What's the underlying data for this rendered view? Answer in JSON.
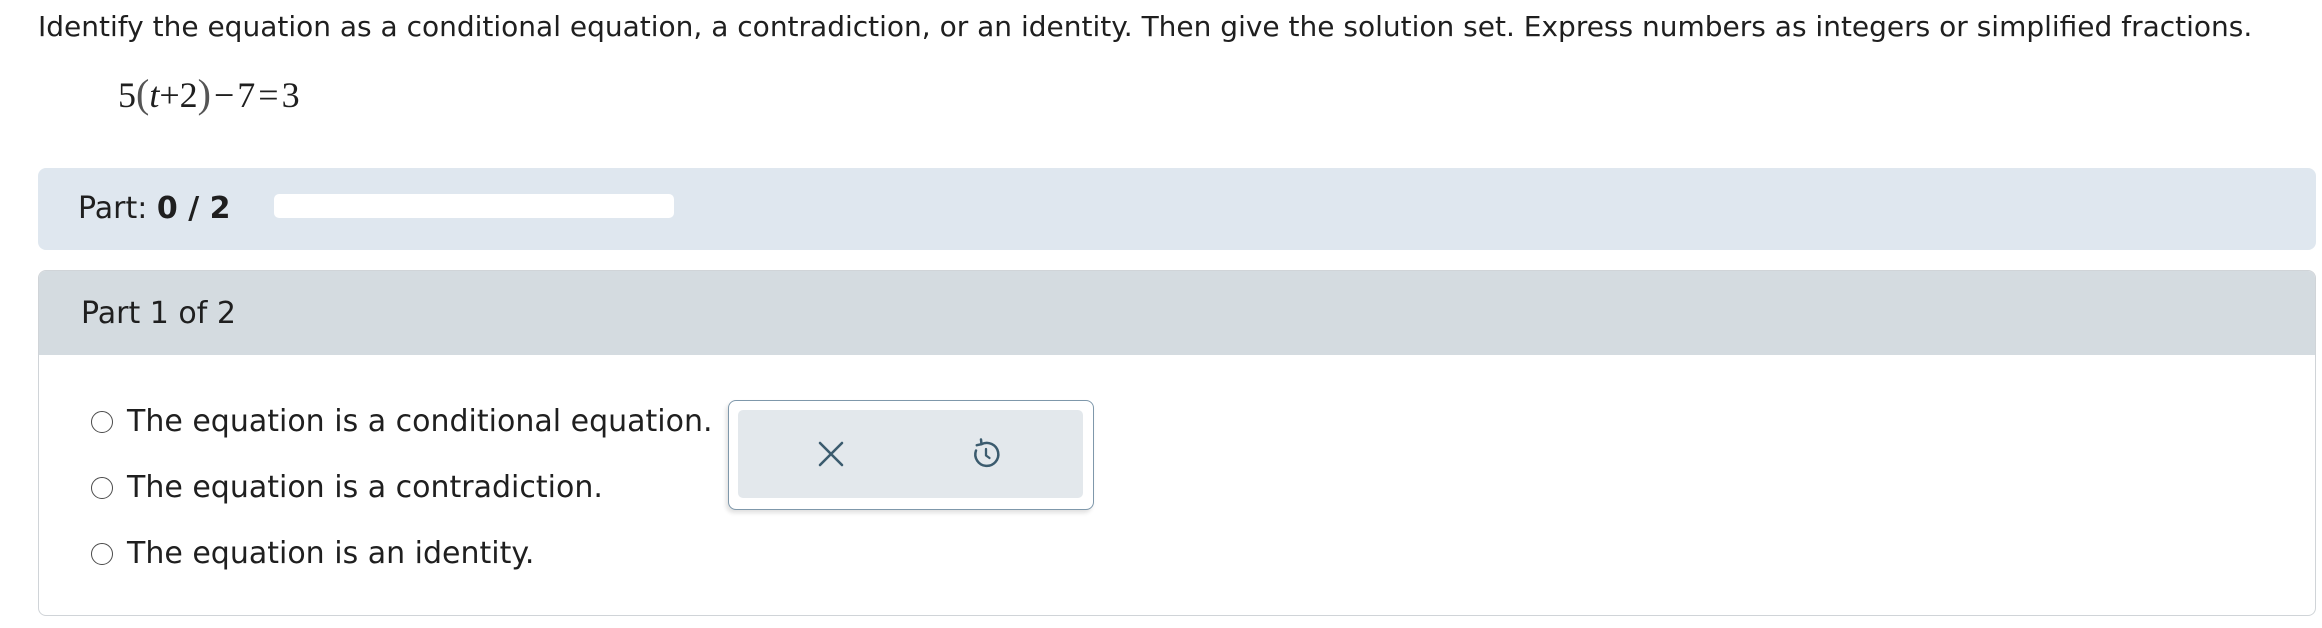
{
  "question": {
    "instructions": "Identify the equation as a conditional equation, a contradiction, or an identity. Then give the solution set. Express numbers as integers or simplified fractions.",
    "equation": {
      "coef": "5",
      "open_paren": "(",
      "variable": "t",
      "plus": "+",
      "inner_const": "2",
      "close_paren": ")",
      "minus": "−",
      "subtrahend": "7",
      "equals": "=",
      "rhs": "3"
    }
  },
  "progress": {
    "label": "Part:",
    "value_text": "0 / 2",
    "fraction": 0.0,
    "fill_color": "#3d7fb8"
  },
  "part": {
    "header": "Part 1 of 2",
    "options": [
      {
        "label": "The equation is a conditional equation.",
        "selected": false
      },
      {
        "label": "The equation is a contradiction.",
        "selected": false
      },
      {
        "label": "The equation is an identity.",
        "selected": false
      }
    ]
  },
  "tools": {
    "clear_icon": "close-icon",
    "undo_icon": "undo-icon",
    "icon_color": "#3b5b6e"
  }
}
